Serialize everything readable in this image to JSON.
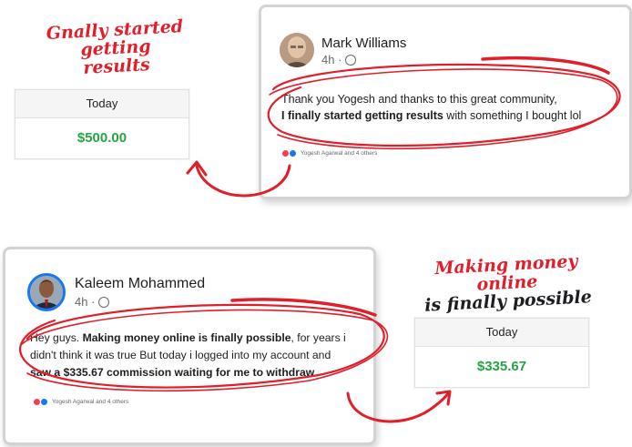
{
  "callout_top": {
    "line1": "Gnally started getting",
    "line2": "results"
  },
  "callout_bottom": {
    "line1": "Making money online",
    "line2": "is finally possible"
  },
  "earnings_top": {
    "header": "Today",
    "amount": "$500.00"
  },
  "earnings_bottom": {
    "header": "Today",
    "amount": "$335.67"
  },
  "post_top": {
    "author": "Mark Williams",
    "time": "4h ·",
    "text_plain_1": "Thank you Yogesh and thanks to this great community,",
    "text_bold_1": "I finally started getting results",
    "text_plain_2": " with something I bought lol",
    "reactions": "Yogesh Agarwal and 4 others"
  },
  "post_bottom": {
    "author": "Kaleem Mohammed",
    "time": "4h ·",
    "text_plain_1": "Hey guys. ",
    "text_bold_1": "Making money online is finally possible",
    "text_plain_2": ", for years i didn't think it was true But today i logged into my account and ",
    "text_bold_2": "saw a $335.67 commission waiting for me to withdraw",
    "reactions": "Yogesh Agarwal and 4 others"
  },
  "colors": {
    "accent_red": "#e01f2a",
    "money_green": "#26a543",
    "text_dark": "#1c1e21",
    "meta_gray": "#65676b"
  },
  "icons": [
    "globe-icon",
    "love-reaction-icon",
    "like-reaction-icon",
    "curved-arrow-icon"
  ]
}
